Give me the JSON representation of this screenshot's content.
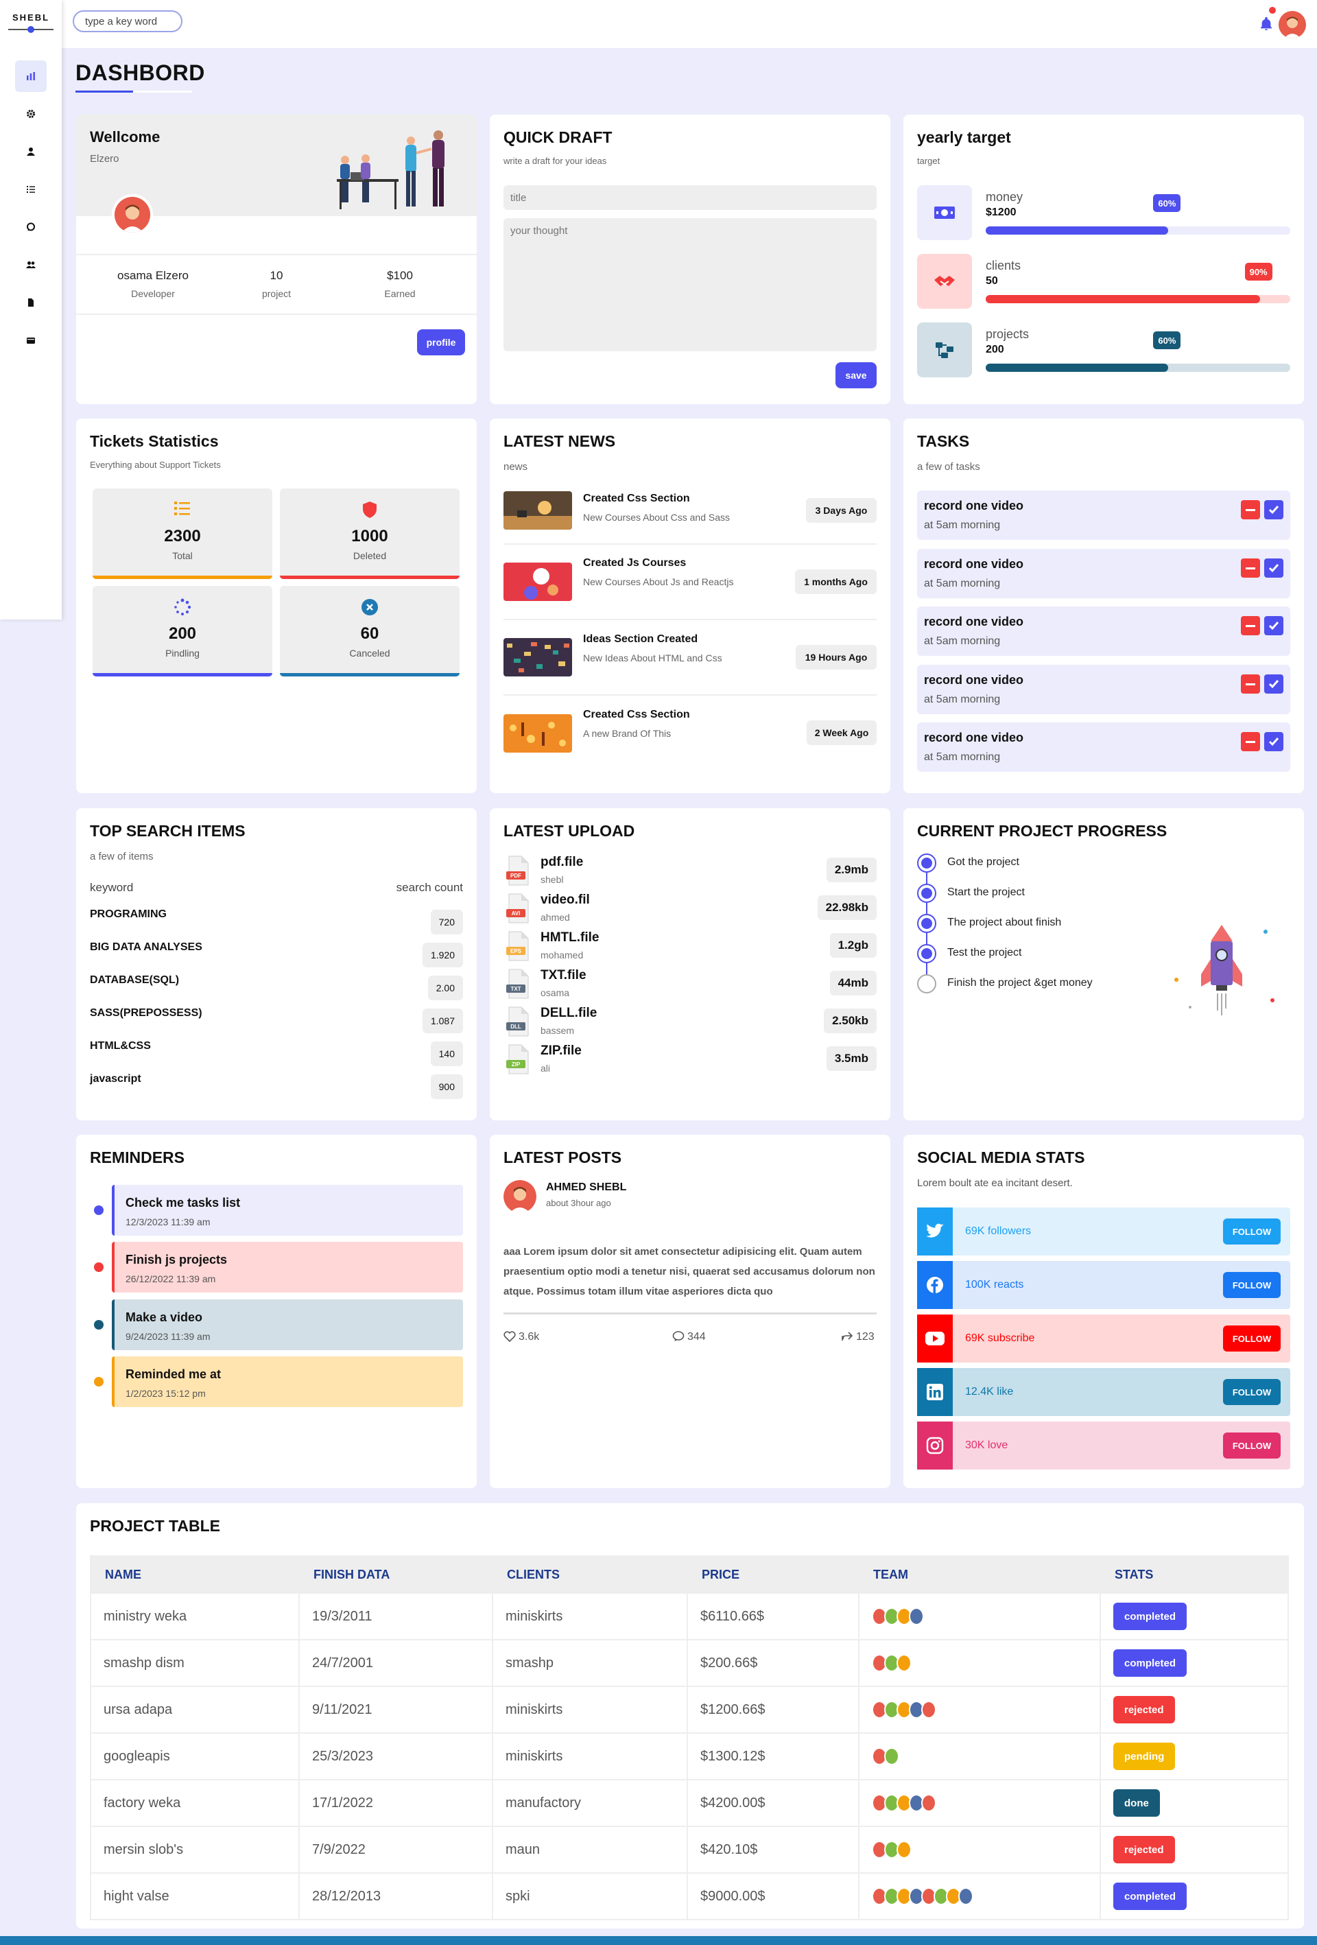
{
  "header": {
    "search_placeholder": "type a key word"
  },
  "sidebar": {
    "brand": "SHEBL"
  },
  "page_title": "DASHBORD",
  "welcome": {
    "title": "Wellcome",
    "subtitle": "Elzero",
    "stats": [
      {
        "value": "osama Elzero",
        "label": "Developer"
      },
      {
        "value": "10",
        "label": "project"
      },
      {
        "value": "$100",
        "label": "Earned"
      }
    ],
    "button": "profile"
  },
  "quick_draft": {
    "title": "QUICK DRAFT",
    "subtitle": "write a draft for your ideas",
    "title_placeholder": "title",
    "body_placeholder": "your thought",
    "button": "save"
  },
  "yearly_target": {
    "title": "yearly target",
    "subtitle": "target",
    "items": [
      {
        "label": "money",
        "value": "$1200",
        "percent": "60%",
        "fraction": 0.6,
        "color": "#4e4fee",
        "track": "#ececfc",
        "bg": "#ececfc"
      },
      {
        "label": "clients",
        "value": "50",
        "percent": "90%",
        "fraction": 0.9,
        "color": "#f23b3b",
        "track": "#ffd7d7",
        "bg": "#ffd7d7"
      },
      {
        "label": "projects",
        "value": "200",
        "percent": "60%",
        "fraction": 0.6,
        "color": "#165a77",
        "track": "#d2dfe6",
        "bg": "#d2dfe6"
      }
    ]
  },
  "tickets": {
    "title": "Tickets Statistics",
    "subtitle": "Everything about Support Tickets",
    "items": [
      {
        "value": "2300",
        "label": "Total",
        "color": "#f59e0b",
        "icon": "list-icon"
      },
      {
        "value": "1000",
        "label": "Deleted",
        "color": "#f23b3b",
        "icon": "shield-icon"
      },
      {
        "value": "200",
        "label": "Pindling",
        "color": "#4e4fee",
        "icon": "spinner-icon"
      },
      {
        "value": "60",
        "label": "Canceled",
        "color": "#1f7ab3",
        "icon": "close-circle-icon"
      }
    ]
  },
  "news": {
    "title": "LATEST NEWS",
    "subtitle": "news",
    "items": [
      {
        "title": "Created Css Section",
        "desc": "New Courses About Css and Sass",
        "time": "3 Days Ago"
      },
      {
        "title": "Created Js Courses",
        "desc": "New Courses About Js and Reactjs",
        "time": "1 months Ago"
      },
      {
        "title": "Ideas Section Created",
        "desc": "New Ideas About HTML and Css",
        "time": "19 Hours Ago"
      },
      {
        "title": "Created Css Section",
        "desc": "A new Brand Of This",
        "time": "2 Week Ago"
      }
    ]
  },
  "tasks": {
    "title": "TASKS",
    "subtitle": "a few of tasks",
    "items": [
      {
        "title": "record one video",
        "sub": "at 5am morning"
      },
      {
        "title": "record one video",
        "sub": "at 5am morning"
      },
      {
        "title": "record one video",
        "sub": "at 5am morning"
      },
      {
        "title": "record one video",
        "sub": "at 5am morning"
      },
      {
        "title": "record one video",
        "sub": "at 5am morning"
      }
    ]
  },
  "search_items": {
    "title": "TOP SEARCH ITEMS",
    "subtitle": "a few of items",
    "col_keyword": "keyword",
    "col_count": "search count",
    "items": [
      {
        "keyword": "PROGRAMING",
        "count": "720"
      },
      {
        "keyword": "BIG DATA ANALYSES",
        "count": "1.920"
      },
      {
        "keyword": "DATABASE(SQL)",
        "count": "2.00"
      },
      {
        "keyword": "SASS(PREPOSSESS)",
        "count": "1.087"
      },
      {
        "keyword": "HTML&CSS",
        "count": "140"
      },
      {
        "keyword": "javascript",
        "count": "900"
      }
    ]
  },
  "uploads": {
    "title": "LATEST UPLOAD",
    "items": [
      {
        "name": "pdf.file",
        "owner": "shebl",
        "size": "2.9mb",
        "tag": "PDF",
        "color": "#e74c3c"
      },
      {
        "name": "video.fil",
        "owner": "ahmed",
        "size": "22.98kb",
        "tag": "AVI",
        "color": "#e74c3c"
      },
      {
        "name": "HMTL.file",
        "owner": "mohamed",
        "size": "1.2gb",
        "tag": "EPS",
        "color": "#f5b041"
      },
      {
        "name": "TXT.file",
        "owner": "osama",
        "size": "44mb",
        "tag": "TXT",
        "color": "#5d6d7e"
      },
      {
        "name": "DELL.file",
        "owner": "bassem",
        "size": "2.50kb",
        "tag": "DLL",
        "color": "#5d6d7e"
      },
      {
        "name": "ZIP.file",
        "owner": "ali",
        "size": "3.5mb",
        "tag": "ZIP",
        "color": "#7dbb42"
      }
    ]
  },
  "progress": {
    "title": "CURRENT PROJECT PROGRESS",
    "steps": [
      {
        "label": "Got the project",
        "done": true
      },
      {
        "label": "Start the project",
        "done": true
      },
      {
        "label": "The project about finish",
        "done": true
      },
      {
        "label": "Test the project",
        "done": true
      },
      {
        "label": "Finish the project &get money",
        "done": false
      }
    ]
  },
  "reminders": {
    "title": "REMINDERS",
    "items": [
      {
        "title": "Check me tasks list",
        "date": "12/3/2023 11:39 am",
        "color": "#4e4fee",
        "bg": "#ececfc"
      },
      {
        "title": "Finish js projects",
        "date": "26/12/2022 11:39 am",
        "color": "#f23b3b",
        "bg": "#ffd7d7"
      },
      {
        "title": "Make a video",
        "date": "9/24/2023 11:39 am",
        "color": "#165a77",
        "bg": "#d2dfe6"
      },
      {
        "title": "Reminded me at",
        "date": "1/2/2023 15:12 pm",
        "color": "#f59e0b",
        "bg": "#ffe4b0"
      }
    ]
  },
  "posts": {
    "title": "LATEST POSTS",
    "author": "AHMED SHEBL",
    "time": "about 3hour ago",
    "body": "aaa Lorem ipsum dolor sit amet consectetur adipisicing elit. Quam autem praesentium optio modi a tenetur nisi, quaerat sed accusamus dolorum non atque. Possimus totam illum vitae asperiores dicta quo",
    "likes": "3.6k",
    "comments": "344",
    "shares": "123"
  },
  "social": {
    "title": "SOCIAL MEDIA STATS",
    "subtitle": "Lorem boult ate ea incitant desert.",
    "items": [
      {
        "network": "twitter",
        "text": "69K followers",
        "button": "FOLLOW",
        "color": "#1da1f2",
        "bg": "#dff1fd"
      },
      {
        "network": "facebook",
        "text": "100K reacts",
        "button": "FOLLOW",
        "color": "#1877f2",
        "bg": "#dce8fb"
      },
      {
        "network": "youtube",
        "text": "69K subscribe",
        "button": "FOLLOW",
        "color": "#ff0000",
        "bg": "#ffd7d7"
      },
      {
        "network": "linkedin",
        "text": "12.4K like",
        "button": "FOLLOW",
        "color": "#0e76a8",
        "bg": "#c5dfeb"
      },
      {
        "network": "instagram",
        "text": "30K love",
        "button": "FOLLOW",
        "color": "#e1306c",
        "bg": "#f9d5e2"
      }
    ]
  },
  "project_table": {
    "title": "PROJECT TABLE",
    "headers": [
      "NAME",
      "FINISH DATA",
      "CLIENTS",
      "PRICE",
      "TEAM",
      "STATS"
    ],
    "rows": [
      {
        "name": "ministry weka",
        "date": "19/3/2011",
        "client": "miniskirts",
        "price": "$6110.66$",
        "team": 4,
        "status": "completed",
        "color": "#4e4fee"
      },
      {
        "name": "smashp dism",
        "date": "24/7/2001",
        "client": "smashp",
        "price": "$200.66$",
        "team": 3,
        "status": "completed",
        "color": "#4e4fee"
      },
      {
        "name": "ursa adapa",
        "date": "9/11/2021",
        "client": "miniskirts",
        "price": "$1200.66$",
        "team": 5,
        "status": "rejected",
        "color": "#f23b3b"
      },
      {
        "name": "googleapis",
        "date": "25/3/2023",
        "client": "miniskirts",
        "price": "$1300.12$",
        "team": 2,
        "status": "pending",
        "color": "#f5b800"
      },
      {
        "name": "factory weka",
        "date": "17/1/2022",
        "client": "manufactory",
        "price": "$4200.00$",
        "team": 5,
        "status": "done",
        "color": "#165a77"
      },
      {
        "name": "mersin slob's",
        "date": "7/9/2022",
        "client": "maun",
        "price": "$420.10$",
        "team": 3,
        "status": "rejected",
        "color": "#f23b3b"
      },
      {
        "name": "hight valse",
        "date": "28/12/2013",
        "client": "spki",
        "price": "$9000.00$",
        "team": 8,
        "status": "completed",
        "color": "#4e4fee"
      }
    ]
  }
}
